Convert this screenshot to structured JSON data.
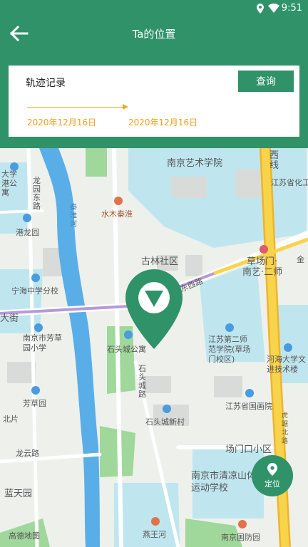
{
  "status": {
    "time": "9:51"
  },
  "header": {
    "title": "Ta的位置"
  },
  "card": {
    "label": "轨迹记录",
    "query_button": "查询",
    "start_date": "2020年12月16日",
    "end_date": "2020年12月16日"
  },
  "map": {
    "labels": {
      "nanjing_art_institute": "南京艺术学院",
      "xian_line": "西线",
      "datongxiang_top": "大学港公寓",
      "jiangsu_chem": "江苏省化工",
      "longyuan_east_road": "龙园东路",
      "qinhuai_river": "秦淮河",
      "shuimu_qinhuai": "水木秦淮",
      "ganglongyuan": "港龙园",
      "gulin_community": "古林社区",
      "caochangmen": "草场门·",
      "nanyi_ershi": "南艺·二师",
      "jin": "金",
      "ninghai_school": "宁海中学分校",
      "east_west_road": "东西路",
      "dajie": "大街",
      "fangcaoyuan_school": "南京市芳草园小学",
      "shitoucheng_apartment": "石头城公寓",
      "jiangsu_normal": "江苏第二师范学院(草场门校区)",
      "hehai_university": "河海大学文进技术楼",
      "shitoucheng_road": "石头城路",
      "fangcaoyuan": "芳草园",
      "jiangsu_painting": "江苏省国画院",
      "shitoucheng_village": "石头城新村",
      "ganglubei": "北片",
      "longyun_road": "龙云路",
      "changmenkou_community": "场门口小区",
      "qingliangshan_school": "南京市清凉山体育运动学校",
      "lantianyuan": "蓝天园",
      "yanwanghe": "燕王河",
      "nanjing_defense_park": "南京国防园",
      "amap": "高德地图",
      "vertical_road": "虎踞北路"
    }
  },
  "locate_button": {
    "label": "定位"
  },
  "colors": {
    "primary": "#2f9268",
    "accent_orange": "#f5a623",
    "road_yellow": "#f7d44c",
    "water": "#5aaee8",
    "park": "#9fd89a",
    "block_blue": "#bfe6ef"
  }
}
